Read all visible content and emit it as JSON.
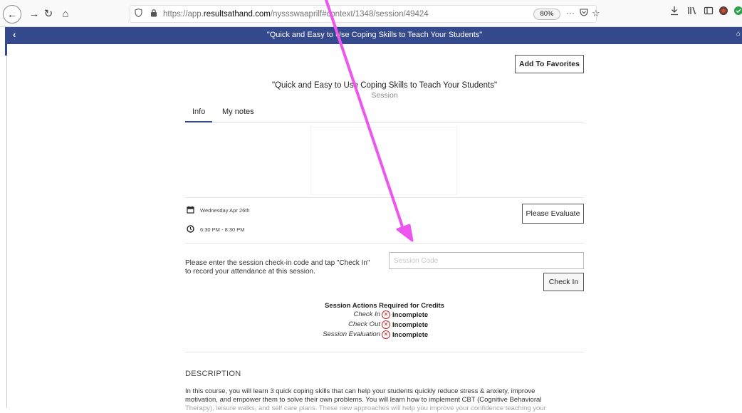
{
  "browser": {
    "back_glyph": "←",
    "forward_glyph": "→",
    "reload_glyph": "↻",
    "home_glyph": "⌂",
    "url_host_prefix": "https://app.",
    "url_host": "resultsathand.com",
    "url_path": "/nyssswaaprilf#context/1348/session/49424",
    "zoom": "80%",
    "more_glyph": "···"
  },
  "app_header": {
    "back_glyph": "‹",
    "title": "\"Quick and Easy to Use Coping Skills to Teach Your Students\""
  },
  "session": {
    "add_favorites_label": "Add To Favorites",
    "title": "\"Quick and Easy to Use Coping Skills to Teach Your Students\"",
    "subtitle": "Session",
    "tabs": [
      {
        "label": "Info"
      },
      {
        "label": "My notes"
      }
    ],
    "date": "Wednesday Apr 26th",
    "time": "6:30 PM - 8:30 PM",
    "evaluate_label": "Please Evaluate"
  },
  "checkin": {
    "prompt": "Please enter the session check-in code and tap \"Check In\" to record your attendance at this session.",
    "placeholder": "Session Code",
    "button_label": "Check In"
  },
  "requirements": {
    "title": "Session Actions Required for Credits",
    "items": [
      {
        "label": "Check In",
        "status": "Incomplete"
      },
      {
        "label": "Check Out",
        "status": "Incomplete"
      },
      {
        "label": "Session Evaluation",
        "status": "Incomplete"
      }
    ]
  },
  "description": {
    "heading": "DESCRIPTION",
    "line1": "In this course, you will learn 3 quick coping skills that can help your students quickly reduce stress & anxiety, improve",
    "line2": "motivation, and empower them to solve their own problems. You will learn how to implement CBT (Cognitive Behavioral",
    "line3": "Therapy), leisure walks, and self care plans. These new approaches will help you improve your confidence teaching your"
  },
  "colors": {
    "header_bg": "#344a8c",
    "annotation_arrow": "#ee55ee",
    "incomplete_red": "#c0282d"
  }
}
